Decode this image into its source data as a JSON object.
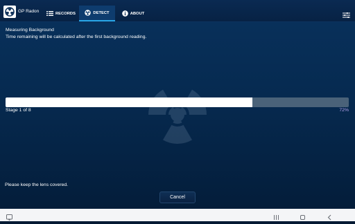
{
  "app": {
    "name": "GP Radon"
  },
  "tabs": [
    {
      "label": "RECORDS",
      "icon": "list-icon"
    },
    {
      "label": "DETECT",
      "icon": "radiation-icon",
      "active": true
    },
    {
      "label": "ABOUT",
      "icon": "info-icon"
    }
  ],
  "status": {
    "title": "Measuring Background",
    "subtitle": "Time remaining will be calculated after the first background reading."
  },
  "progress": {
    "stage_label": "Stage 1 of 8",
    "percent_label": "72%",
    "fraction": 0.72
  },
  "hint": "Please keep the lens covered.",
  "cancel_label": "Cancel",
  "colors": {
    "accent": "#29a6e6",
    "background": "#062a50",
    "progress_fill": "#ffffff",
    "progress_track": "#4a6279",
    "percent_text": "#b9a6ef"
  },
  "system_nav": {
    "icons": [
      "screenshot-icon",
      "recent-apps-icon",
      "home-icon",
      "back-icon"
    ]
  }
}
